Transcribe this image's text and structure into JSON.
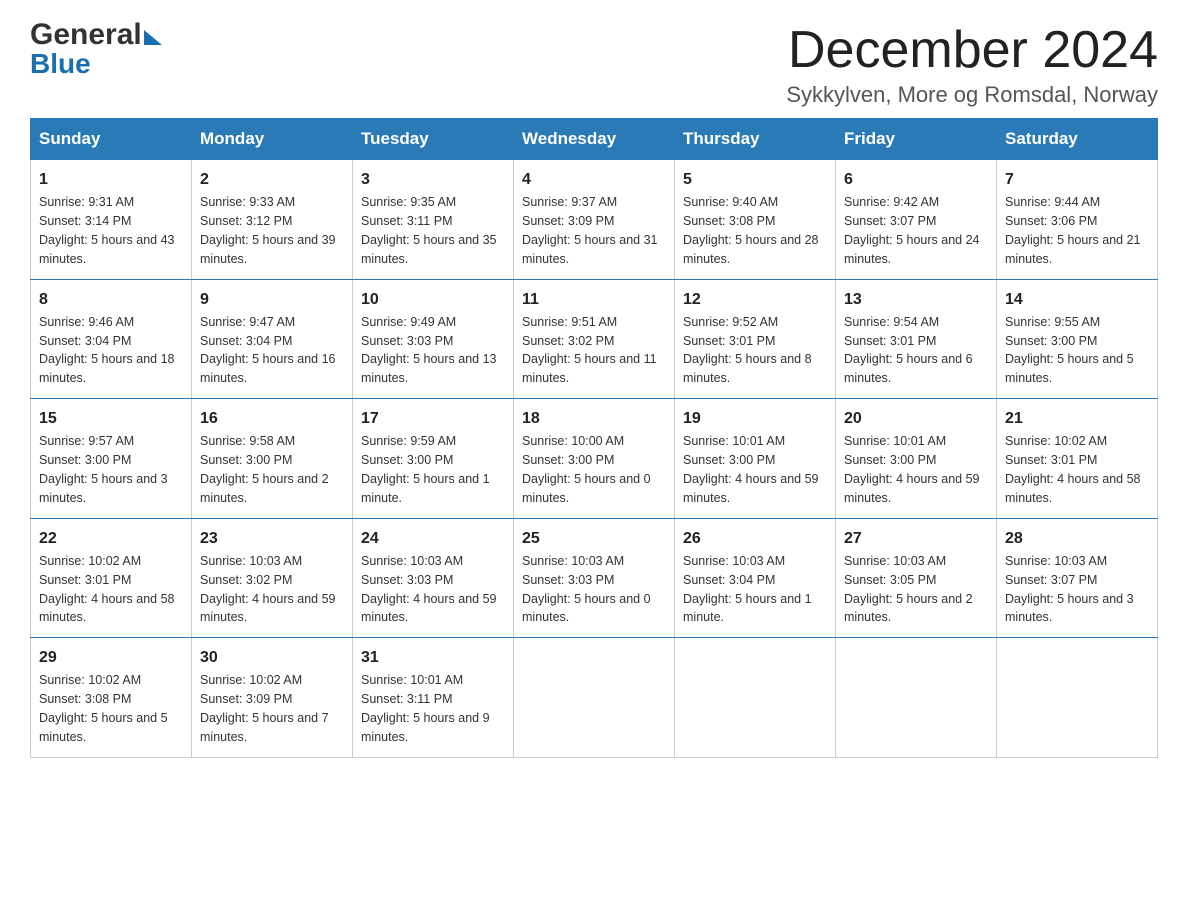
{
  "header": {
    "logo_general": "General",
    "logo_blue": "Blue",
    "month_title": "December 2024",
    "location": "Sykkylven, More og Romsdal, Norway"
  },
  "days_of_week": [
    "Sunday",
    "Monday",
    "Tuesday",
    "Wednesday",
    "Thursday",
    "Friday",
    "Saturday"
  ],
  "weeks": [
    [
      {
        "day": "1",
        "sunrise": "Sunrise: 9:31 AM",
        "sunset": "Sunset: 3:14 PM",
        "daylight": "Daylight: 5 hours and 43 minutes."
      },
      {
        "day": "2",
        "sunrise": "Sunrise: 9:33 AM",
        "sunset": "Sunset: 3:12 PM",
        "daylight": "Daylight: 5 hours and 39 minutes."
      },
      {
        "day": "3",
        "sunrise": "Sunrise: 9:35 AM",
        "sunset": "Sunset: 3:11 PM",
        "daylight": "Daylight: 5 hours and 35 minutes."
      },
      {
        "day": "4",
        "sunrise": "Sunrise: 9:37 AM",
        "sunset": "Sunset: 3:09 PM",
        "daylight": "Daylight: 5 hours and 31 minutes."
      },
      {
        "day": "5",
        "sunrise": "Sunrise: 9:40 AM",
        "sunset": "Sunset: 3:08 PM",
        "daylight": "Daylight: 5 hours and 28 minutes."
      },
      {
        "day": "6",
        "sunrise": "Sunrise: 9:42 AM",
        "sunset": "Sunset: 3:07 PM",
        "daylight": "Daylight: 5 hours and 24 minutes."
      },
      {
        "day": "7",
        "sunrise": "Sunrise: 9:44 AM",
        "sunset": "Sunset: 3:06 PM",
        "daylight": "Daylight: 5 hours and 21 minutes."
      }
    ],
    [
      {
        "day": "8",
        "sunrise": "Sunrise: 9:46 AM",
        "sunset": "Sunset: 3:04 PM",
        "daylight": "Daylight: 5 hours and 18 minutes."
      },
      {
        "day": "9",
        "sunrise": "Sunrise: 9:47 AM",
        "sunset": "Sunset: 3:04 PM",
        "daylight": "Daylight: 5 hours and 16 minutes."
      },
      {
        "day": "10",
        "sunrise": "Sunrise: 9:49 AM",
        "sunset": "Sunset: 3:03 PM",
        "daylight": "Daylight: 5 hours and 13 minutes."
      },
      {
        "day": "11",
        "sunrise": "Sunrise: 9:51 AM",
        "sunset": "Sunset: 3:02 PM",
        "daylight": "Daylight: 5 hours and 11 minutes."
      },
      {
        "day": "12",
        "sunrise": "Sunrise: 9:52 AM",
        "sunset": "Sunset: 3:01 PM",
        "daylight": "Daylight: 5 hours and 8 minutes."
      },
      {
        "day": "13",
        "sunrise": "Sunrise: 9:54 AM",
        "sunset": "Sunset: 3:01 PM",
        "daylight": "Daylight: 5 hours and 6 minutes."
      },
      {
        "day": "14",
        "sunrise": "Sunrise: 9:55 AM",
        "sunset": "Sunset: 3:00 PM",
        "daylight": "Daylight: 5 hours and 5 minutes."
      }
    ],
    [
      {
        "day": "15",
        "sunrise": "Sunrise: 9:57 AM",
        "sunset": "Sunset: 3:00 PM",
        "daylight": "Daylight: 5 hours and 3 minutes."
      },
      {
        "day": "16",
        "sunrise": "Sunrise: 9:58 AM",
        "sunset": "Sunset: 3:00 PM",
        "daylight": "Daylight: 5 hours and 2 minutes."
      },
      {
        "day": "17",
        "sunrise": "Sunrise: 9:59 AM",
        "sunset": "Sunset: 3:00 PM",
        "daylight": "Daylight: 5 hours and 1 minute."
      },
      {
        "day": "18",
        "sunrise": "Sunrise: 10:00 AM",
        "sunset": "Sunset: 3:00 PM",
        "daylight": "Daylight: 5 hours and 0 minutes."
      },
      {
        "day": "19",
        "sunrise": "Sunrise: 10:01 AM",
        "sunset": "Sunset: 3:00 PM",
        "daylight": "Daylight: 4 hours and 59 minutes."
      },
      {
        "day": "20",
        "sunrise": "Sunrise: 10:01 AM",
        "sunset": "Sunset: 3:00 PM",
        "daylight": "Daylight: 4 hours and 59 minutes."
      },
      {
        "day": "21",
        "sunrise": "Sunrise: 10:02 AM",
        "sunset": "Sunset: 3:01 PM",
        "daylight": "Daylight: 4 hours and 58 minutes."
      }
    ],
    [
      {
        "day": "22",
        "sunrise": "Sunrise: 10:02 AM",
        "sunset": "Sunset: 3:01 PM",
        "daylight": "Daylight: 4 hours and 58 minutes."
      },
      {
        "day": "23",
        "sunrise": "Sunrise: 10:03 AM",
        "sunset": "Sunset: 3:02 PM",
        "daylight": "Daylight: 4 hours and 59 minutes."
      },
      {
        "day": "24",
        "sunrise": "Sunrise: 10:03 AM",
        "sunset": "Sunset: 3:03 PM",
        "daylight": "Daylight: 4 hours and 59 minutes."
      },
      {
        "day": "25",
        "sunrise": "Sunrise: 10:03 AM",
        "sunset": "Sunset: 3:03 PM",
        "daylight": "Daylight: 5 hours and 0 minutes."
      },
      {
        "day": "26",
        "sunrise": "Sunrise: 10:03 AM",
        "sunset": "Sunset: 3:04 PM",
        "daylight": "Daylight: 5 hours and 1 minute."
      },
      {
        "day": "27",
        "sunrise": "Sunrise: 10:03 AM",
        "sunset": "Sunset: 3:05 PM",
        "daylight": "Daylight: 5 hours and 2 minutes."
      },
      {
        "day": "28",
        "sunrise": "Sunrise: 10:03 AM",
        "sunset": "Sunset: 3:07 PM",
        "daylight": "Daylight: 5 hours and 3 minutes."
      }
    ],
    [
      {
        "day": "29",
        "sunrise": "Sunrise: 10:02 AM",
        "sunset": "Sunset: 3:08 PM",
        "daylight": "Daylight: 5 hours and 5 minutes."
      },
      {
        "day": "30",
        "sunrise": "Sunrise: 10:02 AM",
        "sunset": "Sunset: 3:09 PM",
        "daylight": "Daylight: 5 hours and 7 minutes."
      },
      {
        "day": "31",
        "sunrise": "Sunrise: 10:01 AM",
        "sunset": "Sunset: 3:11 PM",
        "daylight": "Daylight: 5 hours and 9 minutes."
      },
      null,
      null,
      null,
      null
    ]
  ]
}
